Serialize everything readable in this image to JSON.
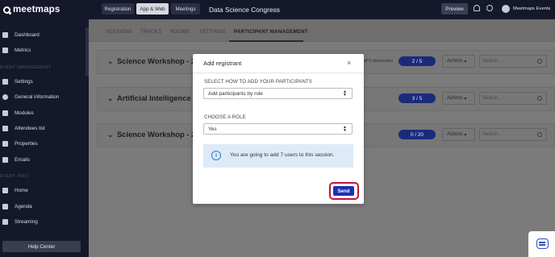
{
  "brand": "meetmaps",
  "topbar": {
    "tabs": [
      "Registration",
      "App & Web",
      "Meetings"
    ],
    "event_name": "Data Science Congress",
    "preview": "Preview",
    "account": "Meetmaps Events"
  },
  "sidebar": {
    "items_top": [
      "Dashboard",
      "Metrics"
    ],
    "section_event": "EVENT MANAGEMENT",
    "items_event": [
      "Settings",
      "General information",
      "Modules",
      "Attendees list",
      "Properties",
      "Emails"
    ],
    "section_info": "EVENT INFO",
    "items_info": [
      "Home",
      "Agenda",
      "Streaming"
    ],
    "help": "Help Center"
  },
  "subtabs": [
    "SESSIONS",
    "TRACKS",
    "ROOMS",
    "SETTINGS",
    "PARTICIPANT MANAGEMENT"
  ],
  "sessions": [
    {
      "title": "Science Workshop - 24/",
      "elements": "of 0 elementos",
      "count": "2 / 5",
      "actions": "Actions",
      "search_placeholder": "Search..."
    },
    {
      "title": "Artificial Intelligence Wo",
      "count": "3 / 5",
      "actions": "Actions",
      "search_placeholder": "Search..."
    },
    {
      "title": "Science Workshop - 24/",
      "count": "0 / 20",
      "actions": "Actions",
      "search_placeholder": "Search..."
    }
  ],
  "modal": {
    "title": "Add registrant",
    "close": "×",
    "label_how": "SELECT HOW TO ADD YOUR PARTICIPANTS",
    "select_how": "Add participants by role",
    "label_role": "CHOOSE A ROLE",
    "select_role": "Yes",
    "info_icon": "i",
    "info_text": "You are going to add 7 users to this session.",
    "send": "Send"
  },
  "colors": {
    "accent": "#1e2fb0",
    "highlight": "#c0143c",
    "sidebar": "#15182a",
    "info_bg": "#dcebf7"
  }
}
